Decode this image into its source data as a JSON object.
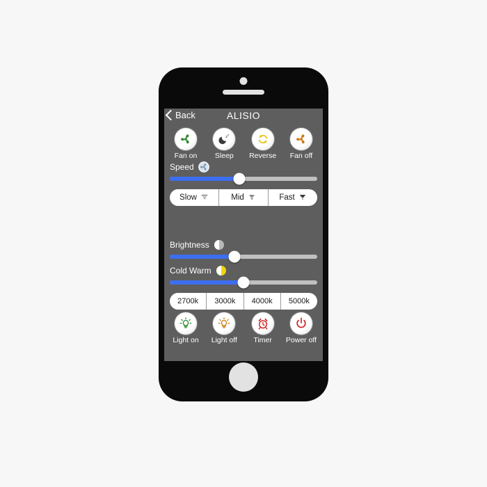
{
  "app": {
    "nav": {
      "back_label": "Back",
      "title": "ALISIO"
    },
    "fan_buttons": [
      {
        "label": "Fan on",
        "icon": "fan-green-icon",
        "color": "#2f8a2f"
      },
      {
        "label": "Sleep",
        "icon": "moon-sleep-icon",
        "color": "#3a3a3a"
      },
      {
        "label": "Reverse",
        "icon": "reverse-arrows-icon",
        "color": "#e8c417"
      },
      {
        "label": "Fan off",
        "icon": "fan-orange-icon",
        "color": "#cc7a12"
      }
    ],
    "speed": {
      "label": "Speed",
      "icon": "fan-speed-icon",
      "value": 47,
      "fill_color": "#3d6ef0",
      "track_color": "#c0c0c0"
    },
    "speed_segments": [
      {
        "label": "Slow",
        "icon": "wind-light-icon"
      },
      {
        "label": "Mid",
        "icon": "wind-medium-icon"
      },
      {
        "label": "Fast",
        "icon": "wind-strong-icon"
      }
    ],
    "brightness": {
      "label": "Brightness",
      "icon": "half-circle-white-icon",
      "value": 44,
      "fill_color": "#3d6ef0",
      "track_color": "#c0c0c0"
    },
    "cold_warm": {
      "label": "Cold Warm",
      "icon": "half-circle-yellow-icon",
      "value": 50,
      "fill_color": "#3d6ef0",
      "track_color": "#c0c0c0"
    },
    "color_temps": [
      {
        "label": "2700k"
      },
      {
        "label": "3000k"
      },
      {
        "label": "4000k"
      },
      {
        "label": "5000k"
      }
    ],
    "light_buttons": [
      {
        "label": "Light on",
        "icon": "bulb-green-icon",
        "color": "#2f8a2f"
      },
      {
        "label": "Light off",
        "icon": "bulb-orange-icon",
        "color": "#cc7a12"
      },
      {
        "label": "Timer",
        "icon": "alarm-clock-icon",
        "color": "#cc2222"
      },
      {
        "label": "Power off",
        "icon": "power-icon",
        "color": "#cc2222"
      }
    ],
    "hardware": {
      "camera": "camera-dot",
      "speaker": "speaker-bar",
      "home": "home-button"
    }
  }
}
